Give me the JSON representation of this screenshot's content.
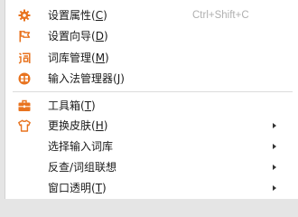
{
  "colors": {
    "icon_accent": "#e8731f",
    "shortcut_text": "#b0b0b0",
    "menu_background": "#ffffff"
  },
  "menu": {
    "items": [
      {
        "icon": "gear-icon",
        "label": "设置属性(",
        "key": "C",
        "close": ")",
        "shortcut": "Ctrl+Shift+C"
      },
      {
        "icon": "flag-icon",
        "label": "设置向导(",
        "key": "D",
        "close": ")"
      },
      {
        "icon": "dictionary-icon",
        "label": "词库管理(",
        "key": "M",
        "close": ")"
      },
      {
        "icon": "input-method-manager-icon",
        "label": "输入法管理器(",
        "key": "J",
        "close": ")"
      },
      {
        "icon": "toolbox-icon",
        "label": "工具箱(",
        "key": "T",
        "close": ")"
      },
      {
        "icon": "shirt-icon",
        "label": "更换皮肤(",
        "key": "H",
        "close": ")",
        "submenu": true
      },
      {
        "label": "选择输入词库",
        "submenu": true
      },
      {
        "label": "反查/词组联想",
        "submenu": true
      },
      {
        "label": "窗口透明(",
        "key": "T",
        "close": ")",
        "submenu": true
      }
    ]
  }
}
